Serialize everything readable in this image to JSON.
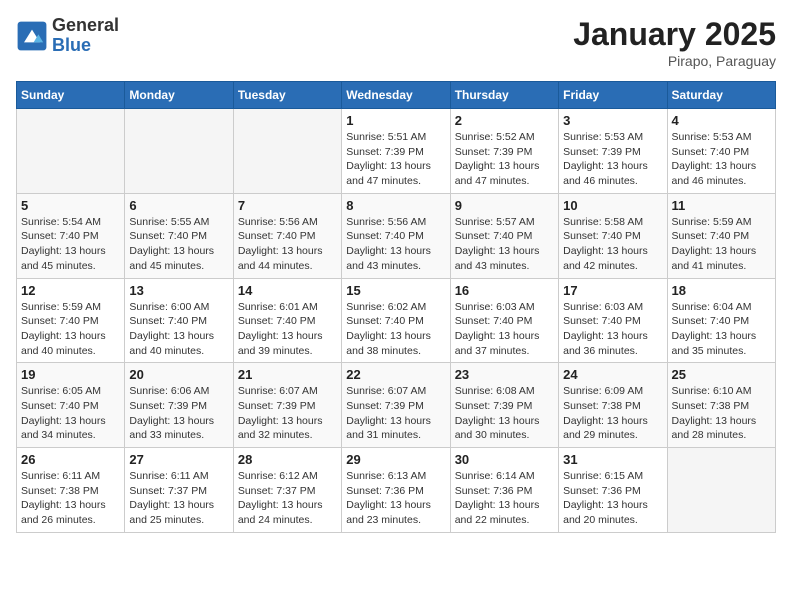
{
  "header": {
    "logo_general": "General",
    "logo_blue": "Blue",
    "month_title": "January 2025",
    "location": "Pirapo, Paraguay"
  },
  "weekdays": [
    "Sunday",
    "Monday",
    "Tuesday",
    "Wednesday",
    "Thursday",
    "Friday",
    "Saturday"
  ],
  "weeks": [
    [
      {
        "day": "",
        "info": ""
      },
      {
        "day": "",
        "info": ""
      },
      {
        "day": "",
        "info": ""
      },
      {
        "day": "1",
        "info": "Sunrise: 5:51 AM\nSunset: 7:39 PM\nDaylight: 13 hours and 47 minutes."
      },
      {
        "day": "2",
        "info": "Sunrise: 5:52 AM\nSunset: 7:39 PM\nDaylight: 13 hours and 47 minutes."
      },
      {
        "day": "3",
        "info": "Sunrise: 5:53 AM\nSunset: 7:39 PM\nDaylight: 13 hours and 46 minutes."
      },
      {
        "day": "4",
        "info": "Sunrise: 5:53 AM\nSunset: 7:40 PM\nDaylight: 13 hours and 46 minutes."
      }
    ],
    [
      {
        "day": "5",
        "info": "Sunrise: 5:54 AM\nSunset: 7:40 PM\nDaylight: 13 hours and 45 minutes."
      },
      {
        "day": "6",
        "info": "Sunrise: 5:55 AM\nSunset: 7:40 PM\nDaylight: 13 hours and 45 minutes."
      },
      {
        "day": "7",
        "info": "Sunrise: 5:56 AM\nSunset: 7:40 PM\nDaylight: 13 hours and 44 minutes."
      },
      {
        "day": "8",
        "info": "Sunrise: 5:56 AM\nSunset: 7:40 PM\nDaylight: 13 hours and 43 minutes."
      },
      {
        "day": "9",
        "info": "Sunrise: 5:57 AM\nSunset: 7:40 PM\nDaylight: 13 hours and 43 minutes."
      },
      {
        "day": "10",
        "info": "Sunrise: 5:58 AM\nSunset: 7:40 PM\nDaylight: 13 hours and 42 minutes."
      },
      {
        "day": "11",
        "info": "Sunrise: 5:59 AM\nSunset: 7:40 PM\nDaylight: 13 hours and 41 minutes."
      }
    ],
    [
      {
        "day": "12",
        "info": "Sunrise: 5:59 AM\nSunset: 7:40 PM\nDaylight: 13 hours and 40 minutes."
      },
      {
        "day": "13",
        "info": "Sunrise: 6:00 AM\nSunset: 7:40 PM\nDaylight: 13 hours and 40 minutes."
      },
      {
        "day": "14",
        "info": "Sunrise: 6:01 AM\nSunset: 7:40 PM\nDaylight: 13 hours and 39 minutes."
      },
      {
        "day": "15",
        "info": "Sunrise: 6:02 AM\nSunset: 7:40 PM\nDaylight: 13 hours and 38 minutes."
      },
      {
        "day": "16",
        "info": "Sunrise: 6:03 AM\nSunset: 7:40 PM\nDaylight: 13 hours and 37 minutes."
      },
      {
        "day": "17",
        "info": "Sunrise: 6:03 AM\nSunset: 7:40 PM\nDaylight: 13 hours and 36 minutes."
      },
      {
        "day": "18",
        "info": "Sunrise: 6:04 AM\nSunset: 7:40 PM\nDaylight: 13 hours and 35 minutes."
      }
    ],
    [
      {
        "day": "19",
        "info": "Sunrise: 6:05 AM\nSunset: 7:40 PM\nDaylight: 13 hours and 34 minutes."
      },
      {
        "day": "20",
        "info": "Sunrise: 6:06 AM\nSunset: 7:39 PM\nDaylight: 13 hours and 33 minutes."
      },
      {
        "day": "21",
        "info": "Sunrise: 6:07 AM\nSunset: 7:39 PM\nDaylight: 13 hours and 32 minutes."
      },
      {
        "day": "22",
        "info": "Sunrise: 6:07 AM\nSunset: 7:39 PM\nDaylight: 13 hours and 31 minutes."
      },
      {
        "day": "23",
        "info": "Sunrise: 6:08 AM\nSunset: 7:39 PM\nDaylight: 13 hours and 30 minutes."
      },
      {
        "day": "24",
        "info": "Sunrise: 6:09 AM\nSunset: 7:38 PM\nDaylight: 13 hours and 29 minutes."
      },
      {
        "day": "25",
        "info": "Sunrise: 6:10 AM\nSunset: 7:38 PM\nDaylight: 13 hours and 28 minutes."
      }
    ],
    [
      {
        "day": "26",
        "info": "Sunrise: 6:11 AM\nSunset: 7:38 PM\nDaylight: 13 hours and 26 minutes."
      },
      {
        "day": "27",
        "info": "Sunrise: 6:11 AM\nSunset: 7:37 PM\nDaylight: 13 hours and 25 minutes."
      },
      {
        "day": "28",
        "info": "Sunrise: 6:12 AM\nSunset: 7:37 PM\nDaylight: 13 hours and 24 minutes."
      },
      {
        "day": "29",
        "info": "Sunrise: 6:13 AM\nSunset: 7:36 PM\nDaylight: 13 hours and 23 minutes."
      },
      {
        "day": "30",
        "info": "Sunrise: 6:14 AM\nSunset: 7:36 PM\nDaylight: 13 hours and 22 minutes."
      },
      {
        "day": "31",
        "info": "Sunrise: 6:15 AM\nSunset: 7:36 PM\nDaylight: 13 hours and 20 minutes."
      },
      {
        "day": "",
        "info": ""
      }
    ]
  ]
}
